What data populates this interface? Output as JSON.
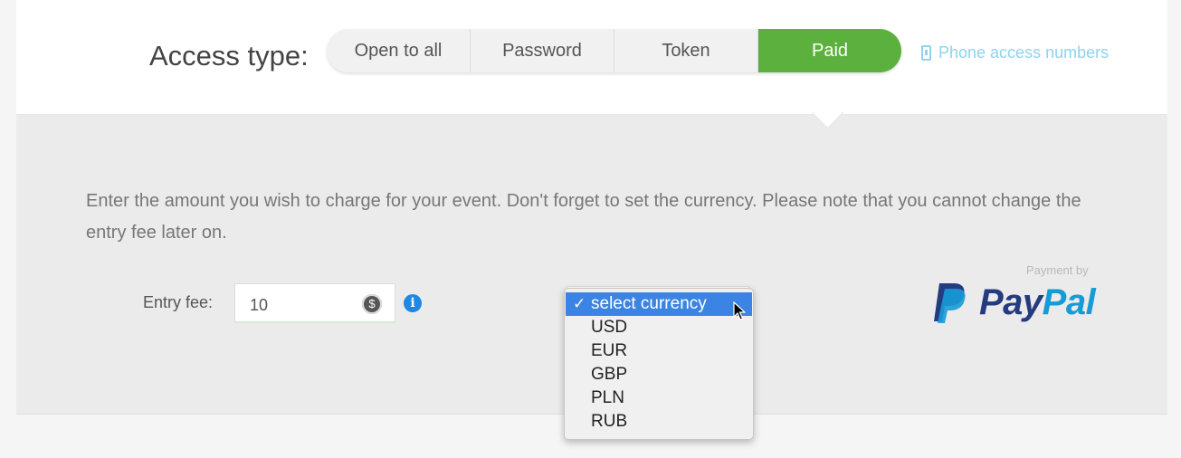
{
  "access": {
    "label": "Access type:",
    "options": [
      "Open to all",
      "Password",
      "Token",
      "Paid"
    ],
    "selected": "Paid",
    "active_color": "#5cb03d"
  },
  "phone_link": {
    "label": "Phone access numbers",
    "icon": "phone-icon",
    "color": "#8fd3ef"
  },
  "description": "Enter the amount you wish to charge for your event. Don't forget to set the currency. Please note that you cannot change the entry fee later on.",
  "entry_fee": {
    "label": "Entry fee:",
    "value": "10",
    "icon": "dollar-coin-icon",
    "info_icon": "info-icon"
  },
  "currency_dropdown": {
    "options": [
      "select currency",
      "USD",
      "EUR",
      "GBP",
      "PLN",
      "RUB"
    ],
    "selected": "select currency",
    "highlight_color": "#3b84e3"
  },
  "payment": {
    "caption": "Payment by",
    "brand_pay": "Pay",
    "brand_pal": "Pal"
  }
}
